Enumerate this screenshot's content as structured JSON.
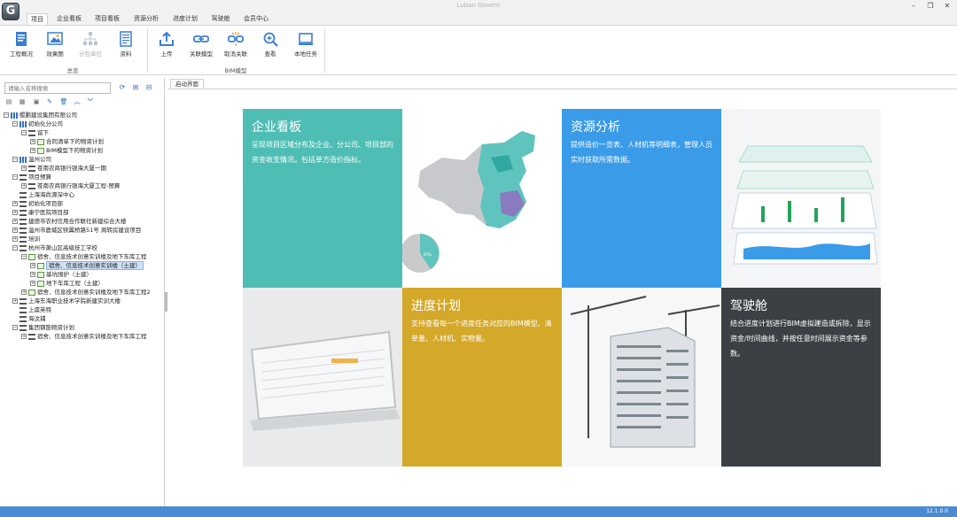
{
  "window": {
    "title": "Luban Govern",
    "min": "–",
    "restore": "❐",
    "close": "✕",
    "logo": "G"
  },
  "tabs": [
    {
      "label": "项目"
    },
    {
      "label": "企业看板"
    },
    {
      "label": "项目看板"
    },
    {
      "label": "资源分析"
    },
    {
      "label": "进度计划"
    },
    {
      "label": "驾驶舱"
    },
    {
      "label": "会员中心"
    }
  ],
  "ribbon": {
    "buttons": [
      {
        "label": "工程概况"
      },
      {
        "label": "效果图"
      },
      {
        "label": "分包单位"
      },
      {
        "label": "资料"
      },
      {
        "label": "上传"
      },
      {
        "label": "关联模型"
      },
      {
        "label": "取消关联"
      },
      {
        "label": "查看"
      },
      {
        "label": "本地任务"
      }
    ],
    "groups": [
      {
        "label": "总览"
      },
      {
        "label": "BIM模型"
      }
    ]
  },
  "sidebar": {
    "search_placeholder": "请输入名称搜索",
    "tree": [
      {
        "label": "鲲鹏建设集团有限公司"
      },
      {
        "label": "初始化分公司"
      },
      {
        "label": "留下"
      },
      {
        "label": "合同清单下的物资计划"
      },
      {
        "label": "BIM模型下的物资计划"
      },
      {
        "label": "温州公司"
      },
      {
        "label": "苍南农商银行银海大厦一期"
      },
      {
        "label": "项目预算"
      },
      {
        "label": "苍南农商银行银海大厦工程-预算"
      },
      {
        "label": "上海海尚源深中心"
      },
      {
        "label": "初始化项目部"
      },
      {
        "label": "康宁医院项目部"
      },
      {
        "label": "建德市农村信用合作联社新建综合大楼"
      },
      {
        "label": "温州市鹿城区犊翼桥路51号 周转房建设项目"
      },
      {
        "label": "培训"
      },
      {
        "label": "杭州市萧山区高级技工学校"
      },
      {
        "label": "宿舍、信息技术创意实训楼及地下车库工程"
      },
      {
        "label": "宿舍、信息技术创意实训楼（土建）"
      },
      {
        "label": "基坑围护（土建）"
      },
      {
        "label": "地下车库工程（土建）"
      },
      {
        "label": "宿舍、信息技术创意实训楼及地下车库工程2"
      },
      {
        "label": "上海东海职业技术学院新建实训大楼"
      },
      {
        "label": "上虞英特"
      },
      {
        "label": "海汶捕"
      },
      {
        "label": "集团钢筋物资计划"
      },
      {
        "label": "宿舍、信息技术创意实训楼及地下车库工程"
      }
    ]
  },
  "content": {
    "tab_label": "启动界面",
    "tiles": [
      {
        "title": "企业看板",
        "desc": "呈现项目区域分布及企业、分公司、项目部的资金收支情况。包括单方造价指标。",
        "color": "#4ebdb4"
      },
      {
        "title": "资源分析",
        "desc": "提供造价一览表、人材机等明细表，管理人员实时获取所需数据。",
        "color": "#3a9be8"
      },
      {
        "title": "进度计划",
        "desc": "支持查看每一个进度任务对应的BIM模型、清单量、人材机、实物量。",
        "color": "#d4a829"
      },
      {
        "title": "驾驶舱",
        "desc": "结合进度计划进行BIM虚拟建造或拆除，显示资金/时间曲线，并按任意时间展示资金等参数。",
        "color": "#3c4045"
      }
    ],
    "pie_label": "65%"
  },
  "status": {
    "version": "12.1.0.0"
  }
}
